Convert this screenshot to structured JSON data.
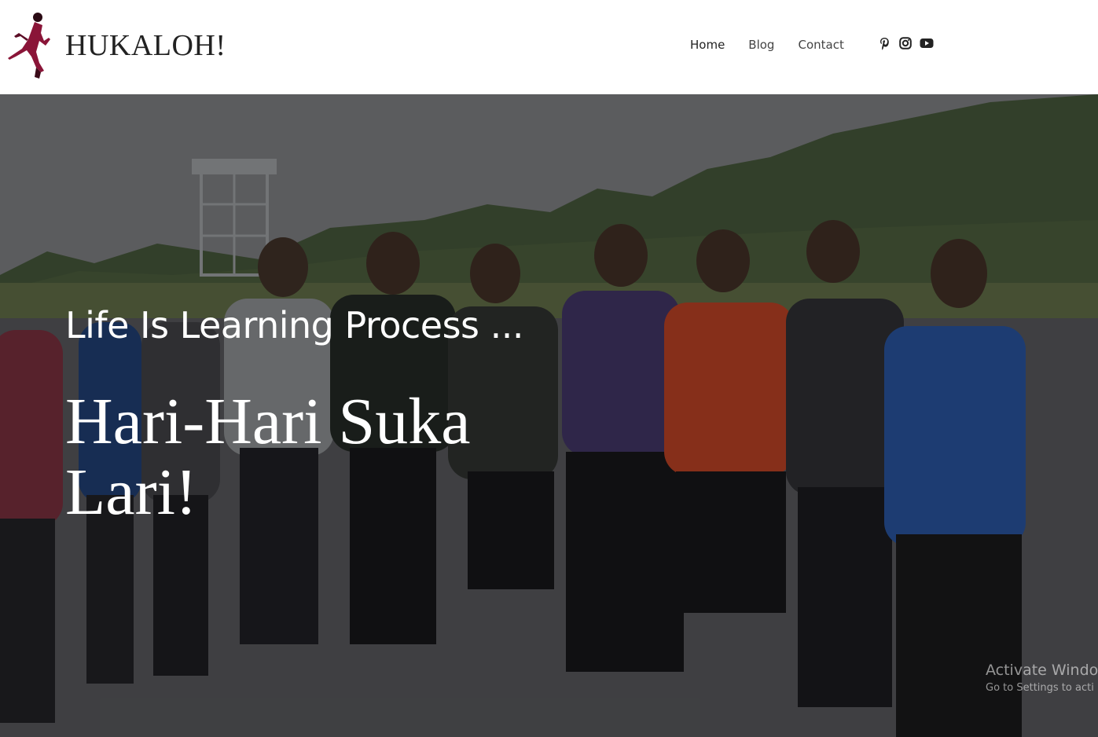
{
  "header": {
    "site_title": "HUKALOH!",
    "logo": "runner-silhouette-logo",
    "nav": [
      {
        "label": "Home"
      },
      {
        "label": "Blog"
      },
      {
        "label": "Contact"
      }
    ],
    "social": [
      "pinterest-icon",
      "instagram-icon",
      "youtube-icon"
    ]
  },
  "hero": {
    "subtitle": "Life Is Learning Process ...",
    "title": "Hari-Hari Suka Lari!",
    "background": "group-photo-of-runners"
  },
  "watermark": {
    "line1": "Activate Window",
    "line2": "Go to Settings to acti"
  },
  "colors": {
    "logo_accent": "#8a1538",
    "text_dark": "#222222",
    "hero_text": "#ffffff"
  }
}
